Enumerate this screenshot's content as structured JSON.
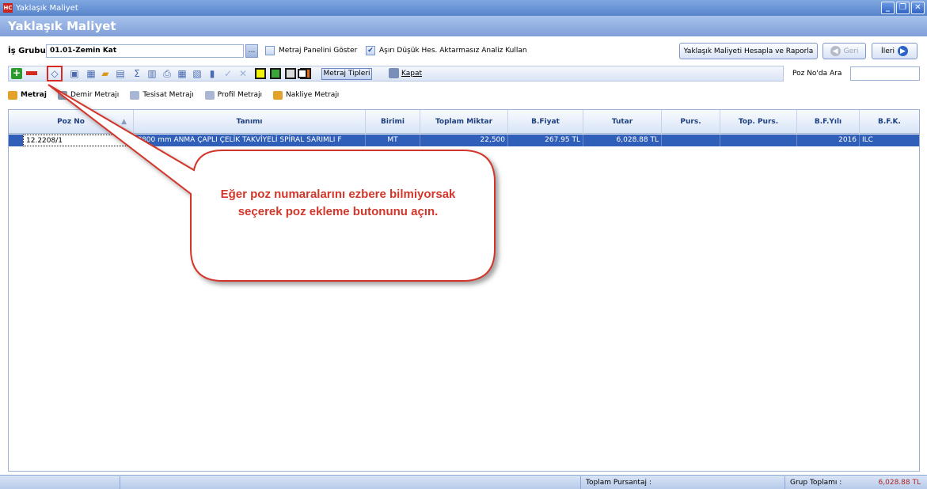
{
  "window": {
    "title": "Yaklaşık Maliyet",
    "app_icon": "HC"
  },
  "header": {
    "title": "Yaklaşık Maliyet"
  },
  "form": {
    "is_grubu_label": "İş Grubu",
    "is_grubu_value": "01.01-Zemin Kat",
    "metraj_panel_label": "Metraj Panelini Göster",
    "metraj_panel_checked": false,
    "asiri_dusuk_label": "Aşırı Düşük Hes. Aktarmasız Analiz Kullan",
    "asiri_dusuk_checked": true,
    "hesapla_button": "Yaklaşık Maliyeti Hesapla ve Raporla",
    "geri_button": "Geri",
    "ileri_button": "İleri"
  },
  "toolbar": {
    "metraj_tipleri": "Metraj Tipleri",
    "kapat": "Kapat",
    "poz_ara_label": "Poz No'da Ara",
    "poz_ara_value": "",
    "square_color": "#f2f20a"
  },
  "tabs": [
    "Metraj",
    "Demir Metrajı",
    "Tesisat Metrajı",
    "Profil Metrajı",
    "Nakliye Metrajı"
  ],
  "grid": {
    "columns": [
      "Poz No",
      "Tanımı",
      "Birimi",
      "Toplam Miktar",
      "B.Fiyat",
      "Tutar",
      "Purs.",
      "Top. Purs.",
      "B.F.Yılı",
      "B.F.K."
    ],
    "rows": [
      {
        "poz_no": "12.2208/1",
        "tanimi": "Ø800 mm ANMA ÇAPLI ÇELİK TAKVİYELİ SPİRAL SARIMLI F",
        "birimi": "MT",
        "toplam_miktar": "22,500",
        "b_fiyat": "267.95  TL",
        "tutar": "6,028.88  TL",
        "purs": "",
        "top_purs": "",
        "bf_yili": "2016",
        "bfk": "ILC"
      }
    ]
  },
  "status": {
    "toplam_pursantaj_label": "Toplam Pursantaj :",
    "toplam_pursantaj_value": "",
    "grup_toplami_label": "Grup Toplamı :",
    "grup_toplami_value": "6,028.88 TL"
  },
  "callout": {
    "text": "Eğer poz numaralarını ezbere bilmiyorsak seçerek poz ekleme butonunu açın.",
    "color": "#d3362b"
  }
}
